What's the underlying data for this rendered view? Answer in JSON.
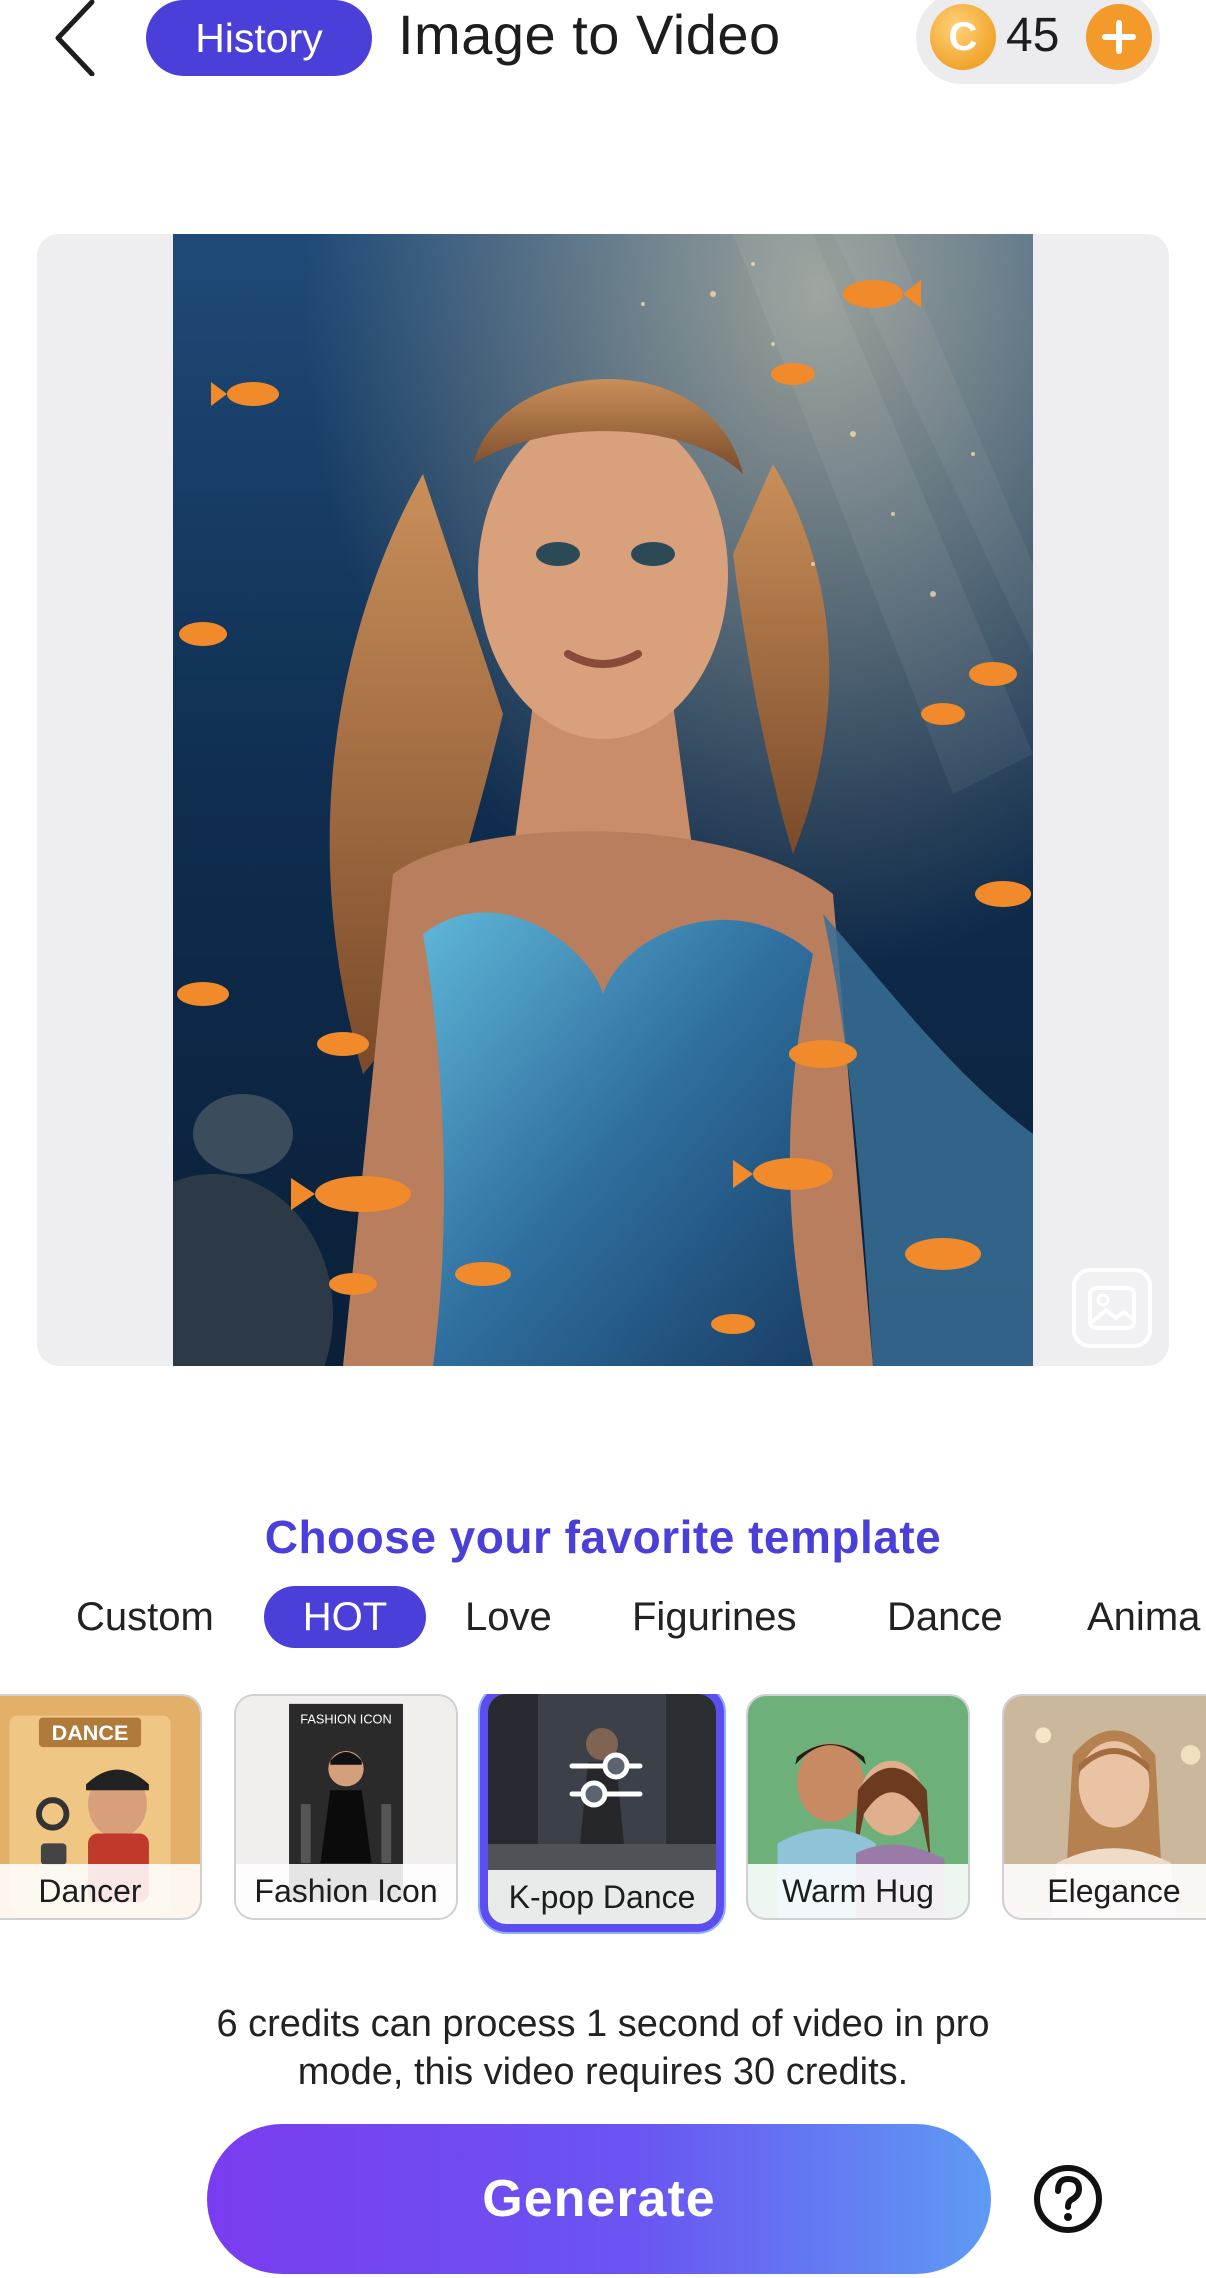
{
  "header": {
    "history_label": "History",
    "title": "Image to Video",
    "credits": "45",
    "coin_symbol": "C"
  },
  "icons": {
    "back": "chevron-left-icon",
    "coin": "coin-icon",
    "add": "plus-icon",
    "change_photo": "image-icon",
    "adjust": "sliders-icon",
    "help": "question-circle-icon"
  },
  "section": {
    "title": "Choose your favorite template"
  },
  "tabs": [
    {
      "label": "Custom",
      "active": false
    },
    {
      "label": "HOT",
      "active": true
    },
    {
      "label": "Love",
      "active": false
    },
    {
      "label": "Figurines",
      "active": false
    },
    {
      "label": "Dance",
      "active": false
    },
    {
      "label": "Anima",
      "active": false
    }
  ],
  "templates": [
    {
      "label": "Dancer",
      "badge": "DANCE",
      "selected": false
    },
    {
      "label": "Fashion Icon",
      "badge": "FASHION ICON",
      "selected": false
    },
    {
      "label": "K-pop Dance",
      "selected": true
    },
    {
      "label": "Warm Hug",
      "selected": false
    },
    {
      "label": "Elegance",
      "selected": false
    }
  ],
  "footer": {
    "info_line1": "6 credits can process 1 second of video in pro",
    "info_line2": "mode, this video requires 30 credits.",
    "generate_label": "Generate"
  },
  "colors": {
    "accent": "#4a3fd8",
    "coin": "#f1a52c",
    "gradient_start": "#7a3cf0",
    "gradient_end": "#5e9bf3"
  }
}
